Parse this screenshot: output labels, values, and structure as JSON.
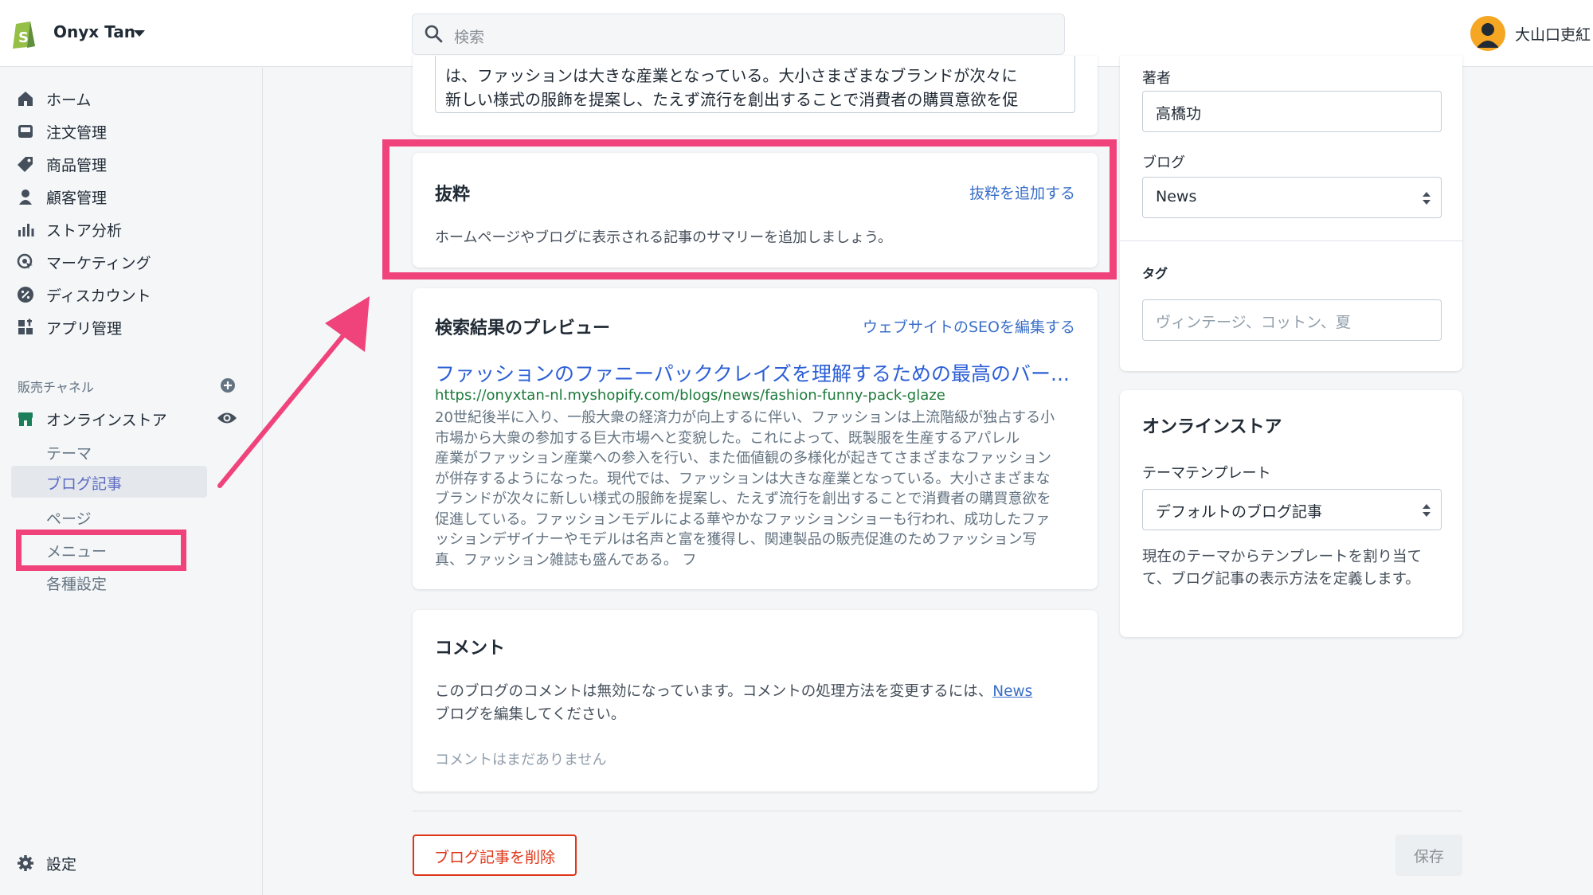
{
  "header": {
    "store_name": "Onyx Tan",
    "search_placeholder": "検索",
    "user_name": "大山口吏紅"
  },
  "sidebar": {
    "items": [
      {
        "label": "ホーム",
        "icon": "home-icon"
      },
      {
        "label": "注文管理",
        "icon": "inbox-icon"
      },
      {
        "label": "商品管理",
        "icon": "tag-icon"
      },
      {
        "label": "顧客管理",
        "icon": "person-icon"
      },
      {
        "label": "ストア分析",
        "icon": "bar-chart-icon"
      },
      {
        "label": "マーケティング",
        "icon": "target-icon"
      },
      {
        "label": "ディスカウント",
        "icon": "discount-icon"
      },
      {
        "label": "アプリ管理",
        "icon": "apps-icon"
      }
    ],
    "sales_channels_title": "販売チャネル",
    "online_store": {
      "label": "オンラインストア",
      "sub_items": [
        "テーマ",
        "ブログ記事",
        "ページ",
        "メニュー",
        "各種設定"
      ],
      "active_sub_item": "ブログ記事"
    },
    "settings_label": "設定"
  },
  "content": {
    "text_line_1": "は、ファッションは大きな産業となっている。大小さまざまなブランドが次々に",
    "text_line_2": "新しい様式の服飾を提案し、たえず流行を創出することで消費者の購買意欲を促"
  },
  "excerpt": {
    "title": "抜粋",
    "action_link": "抜粋を追加する",
    "description": "ホームページやブログに表示される記事のサマリーを追加しましょう。"
  },
  "seo_preview": {
    "title": "検索結果のプレビュー",
    "action_link": "ウェブサイトのSEOを編集する",
    "page_title": "ファッションのファニーパッククレイズを理解するための最高のバー...",
    "url": "https://onyxtan-nl.myshopify.com/blogs/news/fashion-funny-pack-glaze",
    "description_lines": [
      "20世紀後半に入り、一般大衆の経済力が向上するに伴い、ファッションは上流階級が独占する小",
      "市場から大衆の参加する巨大市場へと変貌した。これによって、既製服を生産するアパレル",
      "産業がファッション産業への参入を行い、また価値観の多様化が起きてさまざまなファッション",
      "が併存するようになった。現代では、ファッションは大きな産業となっている。大小さまざまな",
      "ブランドが次々に新しい様式の服飾を提案し、たえず流行を創出することで消費者の購買意欲を",
      "促進している。ファッションモデルによる華やかなファッションショーも行われ、成功したファ",
      "ッションデザイナーやモデルは名声と富を獲得し、関連製品の販売促進のためファッション写",
      "真、ファッション雑誌も盛んである。 フ"
    ]
  },
  "comments": {
    "title": "コメント",
    "text_before_link": "このブログのコメントは無効になっています。コメントの処理方法を変更するには、",
    "link": "News",
    "text_after_link": "ブログを編集してください。",
    "empty_state": "コメントはまだありません"
  },
  "organization": {
    "author_label": "著者",
    "author_value": "高橋功",
    "blog_label": "ブログ",
    "blog_value": "News",
    "tags_label": "タグ",
    "tags_placeholder": "ヴィンテージ、コットン、夏"
  },
  "online_store_card": {
    "title": "オンラインストア",
    "template_label": "テーマテンプレート",
    "template_value": "デフォルトのブログ記事",
    "description": "現在のテーマからテンプレートを割り当てて、ブログ記事の表示方法を定義します。"
  },
  "actions": {
    "delete_label": "ブログ記事を削除",
    "save_label": "保存"
  },
  "colors": {
    "highlight": "#f0437b",
    "link": "#3b6fc8",
    "seo_url": "#1e7a3c",
    "danger": "#de3618",
    "shopify_green": "#95bf47"
  }
}
